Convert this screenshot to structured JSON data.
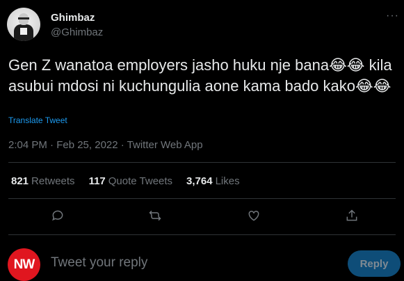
{
  "author": {
    "name": "Ghimbaz",
    "handle": "@Ghimbaz",
    "avatar_icon": "profile-photo"
  },
  "tweet": {
    "text": "Gen Z wanatoa employers jasho huku nje bana😂😂 kila asubui mdosi ni kuchungulia aone kama bado kako😂😂",
    "translate_label": "Translate Tweet",
    "meta": "2:04 PM · Feb 25, 2022 · Twitter Web App"
  },
  "stats": [
    {
      "count": "821",
      "label": "Retweets"
    },
    {
      "count": "117",
      "label": "Quote Tweets"
    },
    {
      "count": "3,764",
      "label": "Likes"
    }
  ],
  "actions": [
    "reply-icon",
    "retweet-icon",
    "like-icon",
    "share-icon"
  ],
  "more_label": "···",
  "reply": {
    "avatar_text": "NW",
    "placeholder": "Tweet your reply",
    "button_label": "Reply"
  },
  "colors": {
    "background": "#000000",
    "text": "#e7e9ea",
    "muted": "#71767b",
    "accent": "#1d9bf0",
    "divider": "#2f3336",
    "reply_avatar": "#e0161f",
    "reply_button": "#0e4d78"
  }
}
